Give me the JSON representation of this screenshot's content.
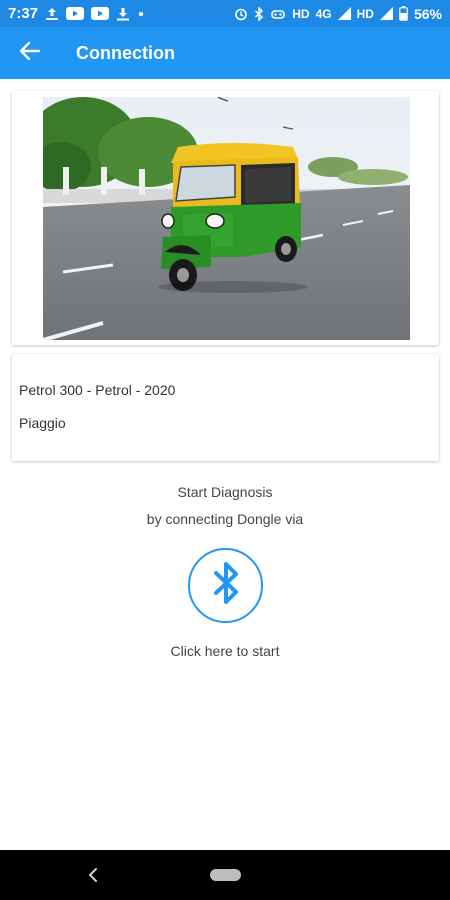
{
  "status_bar": {
    "time": "7:37",
    "network_label_1": "HD",
    "network_label_2": "4G",
    "network_label_3": "HD",
    "battery_percent": "56%",
    "bg_color": "#1e88e5",
    "icons": [
      "upload-icon",
      "youtube-icon",
      "youtube-icon",
      "download-icon",
      "dot-icon",
      "alarm-icon",
      "bluetooth-icon",
      "hotspot-icon",
      "signal-icon",
      "signal-icon",
      "battery-icon"
    ]
  },
  "app_bar": {
    "title": "Connection",
    "back_icon": "arrow-left-icon",
    "color": "#2196f3"
  },
  "vehicle": {
    "model_line": "Petrol 300 - Petrol - 2020",
    "brand": "Piaggio"
  },
  "diagnosis": {
    "line1": "Start Diagnosis",
    "line2": "by connecting Dongle via",
    "button_icon": "bluetooth-icon",
    "cta": "Click here to start"
  },
  "nav_bar": {
    "back_icon": "chevron-left-icon",
    "home_icon": "home-pill-icon"
  }
}
